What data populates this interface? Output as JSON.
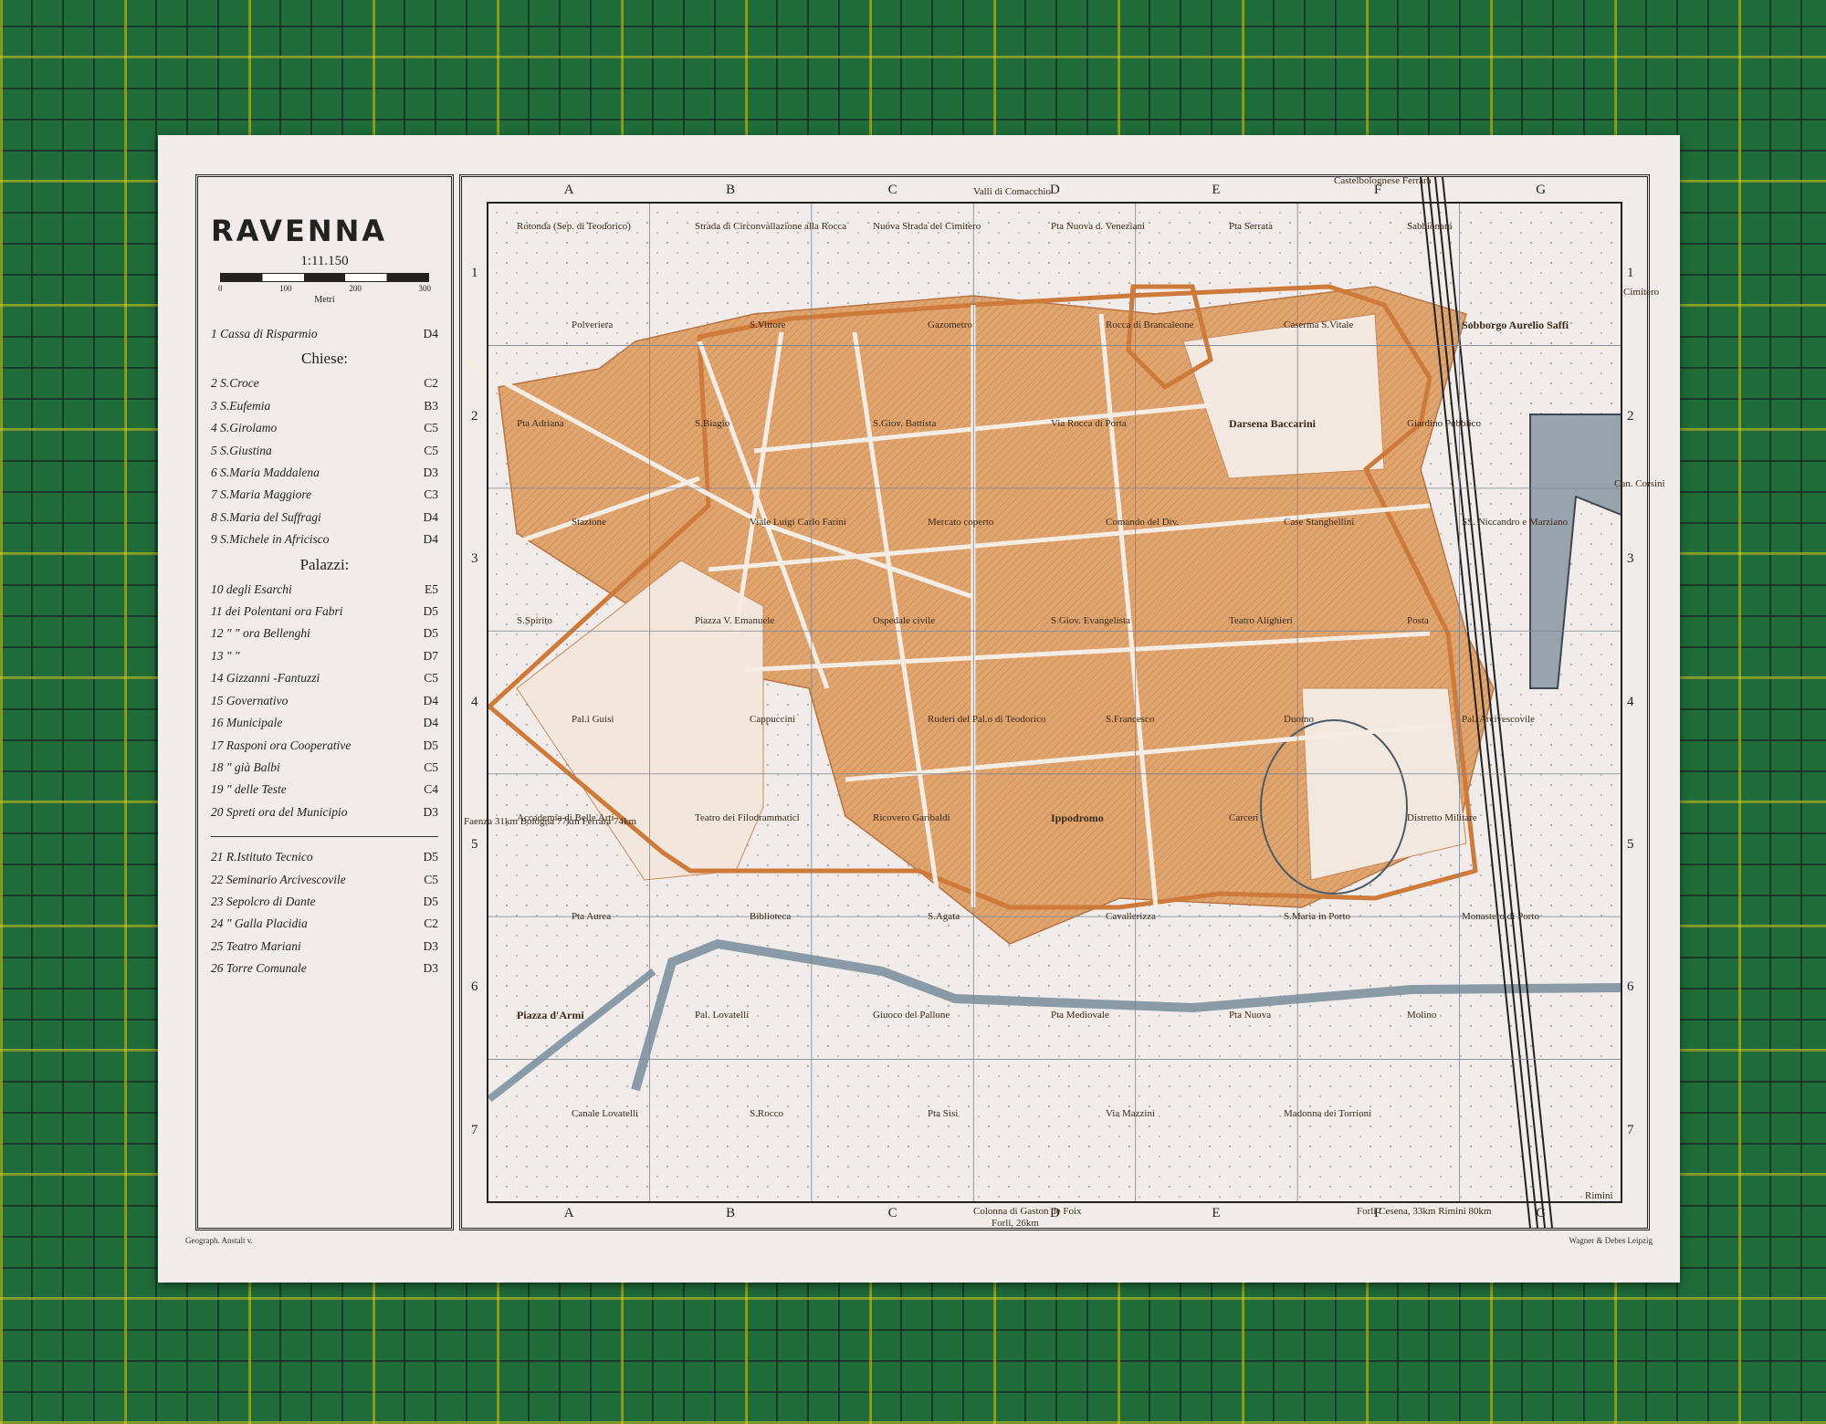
{
  "legend": {
    "title": "RAVENNA",
    "scale": "1:11.150",
    "scale_ticks": [
      "0",
      "100",
      "200",
      "300"
    ],
    "scale_unit": "Metri",
    "item_1": {
      "text": "1 Cassa di Risparmio",
      "grid": "D4"
    },
    "churches_heading": "Chiese:",
    "churches": [
      {
        "text": "2 S.Croce",
        "grid": "C2"
      },
      {
        "text": "3 S.Eufemia",
        "grid": "B3"
      },
      {
        "text": "4 S.Girolamo",
        "grid": "C5"
      },
      {
        "text": "5 S.Giustina",
        "grid": "C5"
      },
      {
        "text": "6 S.Maria Maddalena",
        "grid": "D3"
      },
      {
        "text": "7 S.Maria Maggiore",
        "grid": "C3"
      },
      {
        "text": "8 S.Maria del Suffragi",
        "grid": "D4"
      },
      {
        "text": "9 S.Michele in Africisco",
        "grid": "D4"
      }
    ],
    "palaces_heading": "Palazzi:",
    "palaces": [
      {
        "text": "10 degli Esarchi",
        "grid": "E5"
      },
      {
        "text": "11 dei Polentani ora Fabri",
        "grid": "D5"
      },
      {
        "text": "12 \"  \" ora Bellenghi",
        "grid": "D5"
      },
      {
        "text": "13 \"  \"",
        "grid": "D7"
      },
      {
        "text": "14 Gizzanni -Fantuzzi",
        "grid": "C5"
      },
      {
        "text": "15 Governativo",
        "grid": "D4"
      },
      {
        "text": "16 Municipale",
        "grid": "D4"
      },
      {
        "text": "17 Rasponi ora Cooperative",
        "grid": "D5"
      },
      {
        "text": "18 \" già Balbi",
        "grid": "C5"
      },
      {
        "text": "19 \" delle Teste",
        "grid": "C4"
      },
      {
        "text": "20 Spreti ora del Municipio",
        "grid": "D3"
      }
    ],
    "others": [
      {
        "text": "21 R.Istituto Tecnico",
        "grid": "D5"
      },
      {
        "text": "22 Seminario Arcivescovile",
        "grid": "C5"
      },
      {
        "text": "23 Sepolcro di Dante",
        "grid": "D5"
      },
      {
        "text": "24 \" Galla Placidia",
        "grid": "C2"
      },
      {
        "text": "25 Teatro Mariani",
        "grid": "D3"
      },
      {
        "text": "26 Torre Comunale",
        "grid": "D3"
      }
    ]
  },
  "map": {
    "grid_cols": [
      "A",
      "B",
      "C",
      "D",
      "E",
      "F",
      "G"
    ],
    "grid_rows": [
      "1",
      "2",
      "3",
      "4",
      "5",
      "6",
      "7"
    ],
    "colors": {
      "town": "#e0a56f",
      "wall": "#cd7a3a",
      "water": "#8a9aa6",
      "paper": "#f1ece9"
    },
    "edge_labels": {
      "top": "Valli di Comacchio",
      "top_right": "Castelbolognese Ferrara",
      "bottom": "Colonna di Gaston de Foix",
      "bottom2": "Forli, 26km",
      "bottom_right": "Forli Cesena, 33km Rimini 80km",
      "corner_right": "Rimini",
      "left": "Faenza 31km Bologna 77km Ferrara 74km",
      "right1": "Cimitero",
      "right2": "Can. Corsini"
    },
    "labels": [
      "Rotonda (Sep. di Teodorico)",
      "Strada di Circonvallazione alla Rocca",
      "Nuova Strada del Cimitero",
      "Pta Nuova d. Veneziani",
      "Pta Serrata",
      "Sabbionara",
      "Polveriera",
      "S.Vittore",
      "Gazometro",
      "Rocca di Brancaleone",
      "Caserma S.Vitale",
      "Sobborgo Aurelio Saffi",
      "Pta Adriana",
      "S.Biagio",
      "S.Giov. Battista",
      "Via Rocca di Porta",
      "Darsena Baccarini",
      "Giardino Pubblico",
      "Stazione",
      "Viale Luigi Carlo Farini",
      "Mercato coperto",
      "Comando del Div.",
      "Case Stanghellini",
      "SS. Niccandro e Marziano",
      "S.Spirito",
      "Piazza V. Emanuele",
      "Ospedale civile",
      "S.Giov. Evangelista",
      "Teatro Alighieri",
      "Posta",
      "Pal.i Guisi",
      "Cappuccini",
      "Ruderi del Pal.o di Teodorico",
      "S.Francesco",
      "Duomo",
      "Pal. Arcivescovile",
      "Accademia di Belle Arti",
      "Teatro dei Filodrammatici",
      "Ricovero Garibaldi",
      "Ippodromo",
      "Carceri",
      "Distretto Militare",
      "Pta Aurea",
      "Biblioteca",
      "S.Agata",
      "Cavallerizza",
      "S.Maria in Porto",
      "Monastero di Porto",
      "Piazza d'Armi",
      "Pal. Lovatelli",
      "Giuoco del Pallone",
      "Pta Mediovale",
      "Pta Nuova",
      "Molino",
      "Canale Lovatelli",
      "S.Rocco",
      "Pta Sisi",
      "Via Mazzini",
      "Madonna dei Torrioni"
    ]
  },
  "imprint_left": "Geograph. Anstalt v.",
  "imprint_right": "Wagner & Debes Leipzig"
}
